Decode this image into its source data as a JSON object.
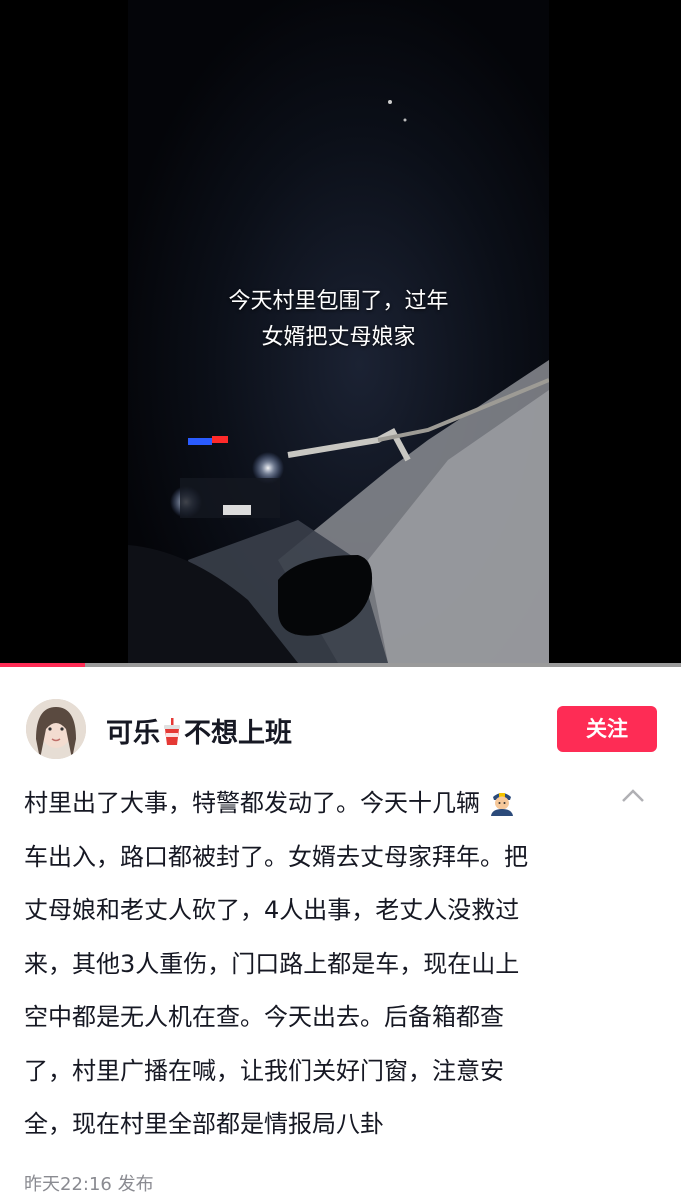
{
  "video": {
    "caption_line1": "今天村里包围了，过年",
    "caption_line2": "女婿把丈母娘家",
    "progress": 0.125
  },
  "author": {
    "name_prefix": "可乐",
    "name_suffix": "不想上班",
    "name_icon": "cola-cup-icon"
  },
  "follow_label": "关注",
  "description": {
    "line1_text": "村里出了大事，特警都发动了。今天十几辆",
    "line1_icon": "police-officer-icon",
    "lines": [
      "车出入，路口都被封了。女婿去丈母家拜年。把",
      "丈母娘和老丈人砍了，4人出事，老丈人没救过",
      "来，其他3人重伤，门口路上都是车，现在山上",
      "空中都是无人机在查。今天出去。后备箱都查",
      "了，村里广播在喊，让我们关好门窗，注意安",
      "全，现在村里全部都是情报局八卦"
    ]
  },
  "post_time": "昨天22:16 发布",
  "colors": {
    "accent": "#fe2c55",
    "text": "#161823",
    "muted": "#8a8b91"
  }
}
